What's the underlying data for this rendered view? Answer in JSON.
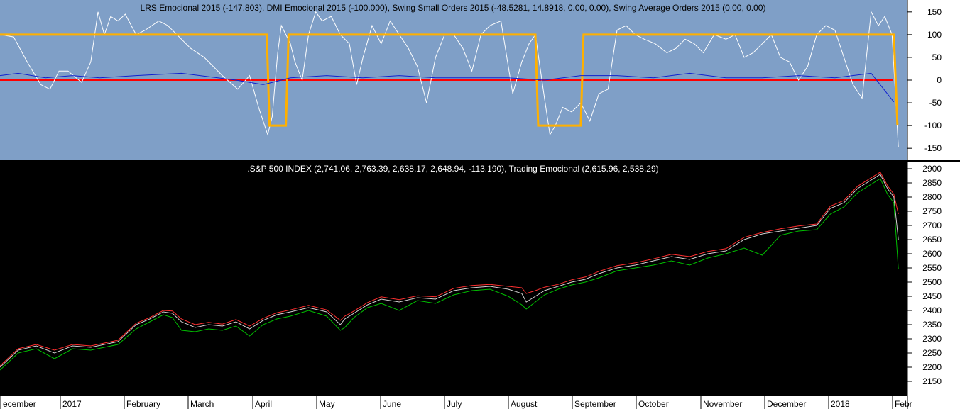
{
  "chart_data": [
    {
      "type": "line",
      "panel": "indicator",
      "title": "LRS Emocional 2015 (-147.803), DMI Emocional 2015 (-100.000), Swing Small Orders 2015 (-48.5281, 14.8918, 0.00, 0.00), Swing Average Orders 2015 (0.00, 0.00)",
      "background": "#7f9fc7",
      "ylim": [
        -170,
        170
      ],
      "yticks": [
        150,
        100,
        50,
        0,
        -50,
        -100,
        -150
      ],
      "xlim": [
        0,
        1
      ],
      "series": [
        {
          "name": "LRS Emocional 2015",
          "color": "#ffffff",
          "x": [
            0.0,
            0.015,
            0.03,
            0.045,
            0.055,
            0.065,
            0.075,
            0.09,
            0.1,
            0.108,
            0.115,
            0.122,
            0.13,
            0.138,
            0.15,
            0.16,
            0.175,
            0.185,
            0.2,
            0.21,
            0.225,
            0.245,
            0.262,
            0.275,
            0.285,
            0.295,
            0.3,
            0.303,
            0.306,
            0.31,
            0.315,
            0.32,
            0.325,
            0.333,
            0.34,
            0.348,
            0.355,
            0.365,
            0.375,
            0.385,
            0.393,
            0.4,
            0.41,
            0.42,
            0.43,
            0.44,
            0.45,
            0.46,
            0.47,
            0.48,
            0.49,
            0.5,
            0.51,
            0.52,
            0.53,
            0.54,
            0.552,
            0.565,
            0.575,
            0.583,
            0.59,
            0.6,
            0.606,
            0.612,
            0.62,
            0.63,
            0.64,
            0.65,
            0.66,
            0.67,
            0.68,
            0.69,
            0.7,
            0.71,
            0.722,
            0.735,
            0.745,
            0.755,
            0.765,
            0.775,
            0.787,
            0.8,
            0.81,
            0.82,
            0.83,
            0.84,
            0.85,
            0.86,
            0.87,
            0.88,
            0.89,
            0.9,
            0.91,
            0.92,
            0.93,
            0.94,
            0.95,
            0.96,
            0.968,
            0.975,
            0.983,
            0.99
          ],
          "y": [
            100,
            95,
            40,
            -10,
            -20,
            20,
            20,
            -5,
            40,
            150,
            100,
            140,
            130,
            145,
            100,
            110,
            130,
            120,
            90,
            70,
            50,
            10,
            -20,
            10,
            -60,
            -120,
            -80,
            -10,
            60,
            120,
            100,
            80,
            40,
            0,
            100,
            150,
            130,
            140,
            100,
            80,
            -10,
            50,
            120,
            80,
            130,
            100,
            70,
            30,
            -50,
            50,
            100,
            100,
            70,
            20,
            100,
            120,
            130,
            -30,
            40,
            80,
            100,
            -40,
            -120,
            -100,
            -60,
            -70,
            -50,
            -90,
            -30,
            -20,
            110,
            120,
            100,
            90,
            80,
            60,
            70,
            90,
            80,
            60,
            100,
            90,
            100,
            50,
            60,
            80,
            100,
            50,
            40,
            0,
            30,
            100,
            120,
            110,
            50,
            -10,
            -40,
            150,
            120,
            140,
            100,
            -148
          ]
        },
        {
          "name": "DMI Emocional 2015",
          "color": "#ffb000",
          "x": [
            0.0,
            0.294,
            0.297,
            0.315,
            0.318,
            0.59,
            0.593,
            0.64,
            0.643,
            0.985,
            0.989
          ],
          "y": [
            100,
            100,
            -100,
            -100,
            100,
            100,
            -100,
            -100,
            100,
            100,
            -100
          ]
        },
        {
          "name": "Swing Small Orders 2015",
          "color": "#1020d0",
          "x": [
            0.0,
            0.02,
            0.05,
            0.08,
            0.11,
            0.15,
            0.2,
            0.24,
            0.26,
            0.29,
            0.32,
            0.36,
            0.4,
            0.44,
            0.48,
            0.52,
            0.56,
            0.6,
            0.64,
            0.68,
            0.72,
            0.76,
            0.8,
            0.84,
            0.88,
            0.92,
            0.96,
            0.985
          ],
          "y": [
            10,
            15,
            5,
            10,
            5,
            10,
            15,
            5,
            0,
            -10,
            5,
            10,
            5,
            10,
            5,
            5,
            5,
            0,
            10,
            10,
            5,
            15,
            5,
            5,
            10,
            5,
            15,
            -48
          ]
        }
      ]
    },
    {
      "type": "line",
      "panel": "price",
      "title": ".S&P 500 INDEX (2,741.06, 2,763.39, 2,638.17, 2,648.94, -113.190), Trading Emocional (2,615.96, 2,538.29)",
      "background": "#000000",
      "ylim": [
        2115,
        2915
      ],
      "yticks": [
        2900,
        2850,
        2800,
        2750,
        2700,
        2650,
        2600,
        2550,
        2500,
        2450,
        2400,
        2350,
        2300,
        2250,
        2200,
        2150
      ],
      "x_months": [
        "ecember",
        "2017",
        "February",
        "March",
        "April",
        "May",
        "June",
        "July",
        "August",
        "September",
        "October",
        "November",
        "December",
        "2018",
        "Febr"
      ],
      "xlim": [
        0,
        1
      ],
      "series": [
        {
          "name": ".S&P 500 INDEX",
          "color": "#d0d0d0",
          "x": [
            0.0,
            0.02,
            0.04,
            0.06,
            0.08,
            0.1,
            0.115,
            0.13,
            0.15,
            0.165,
            0.18,
            0.19,
            0.2,
            0.215,
            0.23,
            0.245,
            0.26,
            0.275,
            0.29,
            0.305,
            0.32,
            0.34,
            0.36,
            0.375,
            0.38,
            0.39,
            0.405,
            0.42,
            0.44,
            0.46,
            0.48,
            0.5,
            0.52,
            0.54,
            0.56,
            0.575,
            0.58,
            0.59,
            0.6,
            0.615,
            0.63,
            0.645,
            0.66,
            0.68,
            0.7,
            0.72,
            0.74,
            0.76,
            0.78,
            0.8,
            0.82,
            0.84,
            0.86,
            0.88,
            0.9,
            0.915,
            0.93,
            0.945,
            0.96,
            0.97,
            0.978,
            0.985,
            0.99
          ],
          "y": [
            2200,
            2260,
            2275,
            2250,
            2275,
            2270,
            2280,
            2290,
            2350,
            2370,
            2395,
            2390,
            2360,
            2340,
            2350,
            2345,
            2360,
            2335,
            2365,
            2385,
            2395,
            2410,
            2395,
            2350,
            2370,
            2390,
            2420,
            2440,
            2430,
            2445,
            2440,
            2470,
            2480,
            2485,
            2475,
            2460,
            2430,
            2450,
            2470,
            2485,
            2500,
            2510,
            2530,
            2550,
            2560,
            2575,
            2590,
            2580,
            2600,
            2610,
            2650,
            2670,
            2680,
            2690,
            2700,
            2760,
            2780,
            2830,
            2860,
            2880,
            2830,
            2800,
            2650
          ]
        },
        {
          "name": "Trading Emocional",
          "color": "#00c000",
          "x": [
            0.0,
            0.02,
            0.04,
            0.06,
            0.08,
            0.1,
            0.115,
            0.13,
            0.15,
            0.165,
            0.18,
            0.19,
            0.2,
            0.215,
            0.23,
            0.245,
            0.26,
            0.275,
            0.29,
            0.305,
            0.32,
            0.34,
            0.36,
            0.375,
            0.38,
            0.39,
            0.405,
            0.42,
            0.44,
            0.46,
            0.48,
            0.5,
            0.52,
            0.54,
            0.56,
            0.575,
            0.58,
            0.59,
            0.6,
            0.615,
            0.63,
            0.645,
            0.66,
            0.68,
            0.7,
            0.72,
            0.74,
            0.76,
            0.78,
            0.8,
            0.82,
            0.84,
            0.86,
            0.88,
            0.9,
            0.915,
            0.93,
            0.945,
            0.96,
            0.97,
            0.978,
            0.985,
            0.99
          ],
          "y": [
            2190,
            2250,
            2265,
            2230,
            2265,
            2260,
            2270,
            2280,
            2335,
            2360,
            2385,
            2375,
            2330,
            2325,
            2335,
            2330,
            2345,
            2310,
            2350,
            2370,
            2380,
            2400,
            2380,
            2330,
            2340,
            2375,
            2410,
            2425,
            2400,
            2435,
            2425,
            2455,
            2470,
            2475,
            2450,
            2420,
            2405,
            2430,
            2455,
            2475,
            2490,
            2500,
            2515,
            2540,
            2550,
            2560,
            2575,
            2560,
            2585,
            2600,
            2620,
            2595,
            2665,
            2680,
            2685,
            2740,
            2765,
            2815,
            2845,
            2865,
            2810,
            2780,
            2545
          ]
        },
        {
          "name": "",
          "color": "#ff3030",
          "x": [
            0.0,
            0.02,
            0.04,
            0.06,
            0.08,
            0.1,
            0.115,
            0.13,
            0.15,
            0.165,
            0.18,
            0.19,
            0.2,
            0.215,
            0.23,
            0.245,
            0.26,
            0.275,
            0.29,
            0.305,
            0.32,
            0.34,
            0.36,
            0.375,
            0.38,
            0.39,
            0.405,
            0.42,
            0.44,
            0.46,
            0.48,
            0.5,
            0.52,
            0.54,
            0.56,
            0.575,
            0.58,
            0.59,
            0.6,
            0.615,
            0.63,
            0.645,
            0.66,
            0.68,
            0.7,
            0.72,
            0.74,
            0.76,
            0.78,
            0.8,
            0.82,
            0.84,
            0.86,
            0.88,
            0.9,
            0.915,
            0.93,
            0.945,
            0.96,
            0.97,
            0.978,
            0.985,
            0.99
          ],
          "y": [
            2205,
            2265,
            2280,
            2260,
            2280,
            2275,
            2285,
            2295,
            2355,
            2375,
            2400,
            2398,
            2370,
            2350,
            2358,
            2352,
            2368,
            2345,
            2372,
            2392,
            2402,
            2418,
            2402,
            2365,
            2380,
            2398,
            2428,
            2448,
            2438,
            2452,
            2448,
            2478,
            2488,
            2492,
            2485,
            2480,
            2460,
            2470,
            2482,
            2492,
            2508,
            2518,
            2538,
            2558,
            2568,
            2582,
            2598,
            2590,
            2608,
            2618,
            2658,
            2675,
            2688,
            2698,
            2705,
            2768,
            2788,
            2838,
            2868,
            2888,
            2840,
            2810,
            2740
          ]
        }
      ]
    }
  ]
}
